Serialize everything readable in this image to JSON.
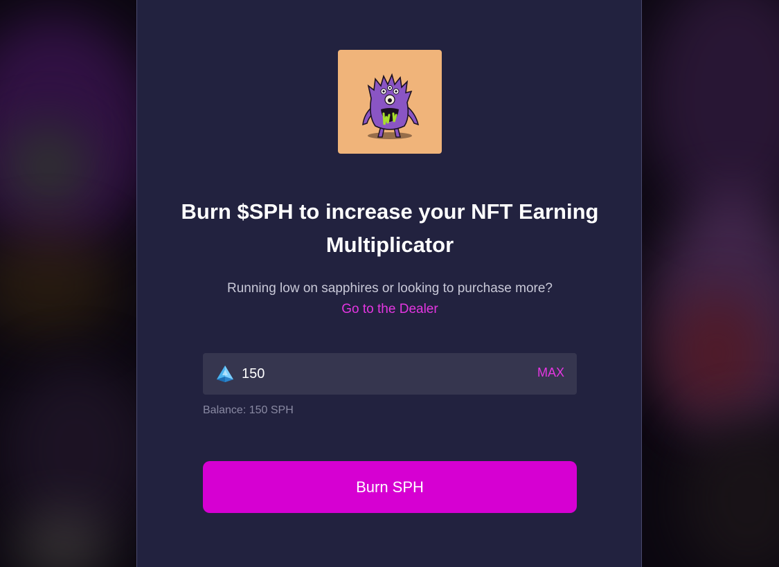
{
  "modal": {
    "nft_image_alt": "NFT monster",
    "headline": "Burn $SPH to increase your NFT Earning Multiplicator",
    "subtext": "Running low on sapphires or looking to purchase more?",
    "dealer_link": "Go to the Dealer"
  },
  "amount": {
    "value": "150",
    "max_label": "MAX",
    "icon": "sapphire-gem-icon"
  },
  "balance": {
    "text": "Balance: 150 SPH"
  },
  "actions": {
    "burn_label": "Burn SPH"
  },
  "colors": {
    "panel": "#22223f",
    "accent": "#d600d2",
    "link": "#e536e2",
    "input_bg": "#36364f",
    "nft_bg": "#f0b47a"
  }
}
